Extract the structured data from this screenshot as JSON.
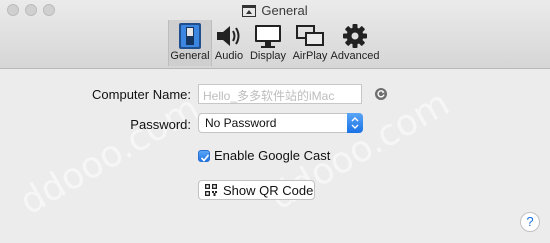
{
  "window": {
    "title": "General"
  },
  "toolbar": {
    "tabs": [
      {
        "label": "General",
        "icon": "general-switch-icon",
        "selected": true
      },
      {
        "label": "Audio",
        "icon": "speaker-icon",
        "selected": false
      },
      {
        "label": "Display",
        "icon": "monitor-icon",
        "selected": false
      },
      {
        "label": "AirPlay",
        "icon": "airplay-mirroring-icon",
        "selected": false
      },
      {
        "label": "Advanced",
        "icon": "gear-icon",
        "selected": false
      }
    ]
  },
  "form": {
    "computer_name_label": "Computer Name:",
    "computer_name_placeholder": "Hello_多多软件站的iMac",
    "password_label": "Password:",
    "password_value": "No Password",
    "enable_cast_label": "Enable Google Cast",
    "enable_cast_checked": true,
    "show_qr_label": "Show QR Code"
  },
  "help": {
    "label": "?"
  },
  "watermark": {
    "text": "ddooo.com"
  },
  "colors": {
    "accent": "#1d76e8",
    "toolbar_bg": "#dcdcdc",
    "window_bg": "#ececec"
  }
}
